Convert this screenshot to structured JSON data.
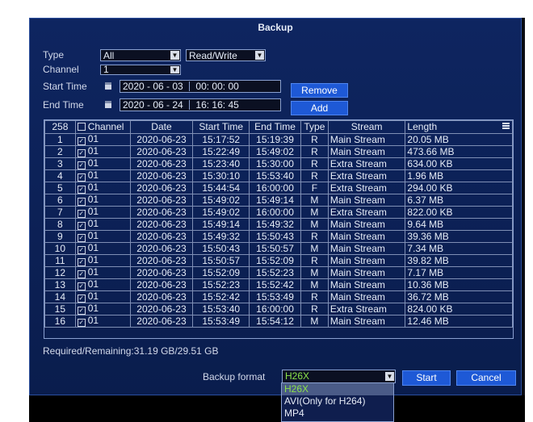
{
  "window": {
    "title": "Backup"
  },
  "filters": {
    "type_label": "Type",
    "type_value": "All",
    "rw_value": "Read/Write",
    "channel_label": "Channel",
    "channel_value": "1",
    "start_label": "Start Time",
    "start_date": "2020 - 06 - 03",
    "start_time": "00: 00: 00",
    "end_label": "End Time",
    "end_date": "2020 - 06 - 24",
    "end_time": "16: 16: 45",
    "remove_label": "Remove",
    "add_label": "Add"
  },
  "table": {
    "count": "258",
    "headers": [
      "Channel",
      "Date",
      "Start Time",
      "End Time",
      "Type",
      "Stream",
      "Length"
    ],
    "rows": [
      {
        "n": "1",
        "ch": "01",
        "date": "2020-06-23",
        "start": "15:17:52",
        "end": "15:19:39",
        "type": "R",
        "stream": "Main Stream",
        "len": "20.05 MB"
      },
      {
        "n": "2",
        "ch": "01",
        "date": "2020-06-23",
        "start": "15:22:49",
        "end": "15:49:02",
        "type": "R",
        "stream": "Main Stream",
        "len": "473.66 MB"
      },
      {
        "n": "3",
        "ch": "01",
        "date": "2020-06-23",
        "start": "15:23:40",
        "end": "15:30:00",
        "type": "R",
        "stream": "Extra Stream",
        "len": "634.00 KB"
      },
      {
        "n": "4",
        "ch": "01",
        "date": "2020-06-23",
        "start": "15:30:10",
        "end": "15:53:40",
        "type": "R",
        "stream": "Extra Stream",
        "len": "1.96 MB"
      },
      {
        "n": "5",
        "ch": "01",
        "date": "2020-06-23",
        "start": "15:44:54",
        "end": "16:00:00",
        "type": "F",
        "stream": "Extra Stream",
        "len": "294.00 KB"
      },
      {
        "n": "6",
        "ch": "01",
        "date": "2020-06-23",
        "start": "15:49:02",
        "end": "15:49:14",
        "type": "M",
        "stream": "Main Stream",
        "len": "6.37 MB"
      },
      {
        "n": "7",
        "ch": "01",
        "date": "2020-06-23",
        "start": "15:49:02",
        "end": "16:00:00",
        "type": "M",
        "stream": "Extra Stream",
        "len": "822.00 KB"
      },
      {
        "n": "8",
        "ch": "01",
        "date": "2020-06-23",
        "start": "15:49:14",
        "end": "15:49:32",
        "type": "M",
        "stream": "Main Stream",
        "len": "9.64 MB"
      },
      {
        "n": "9",
        "ch": "01",
        "date": "2020-06-23",
        "start": "15:49:32",
        "end": "15:50:43",
        "type": "R",
        "stream": "Main Stream",
        "len": "39.36 MB"
      },
      {
        "n": "10",
        "ch": "01",
        "date": "2020-06-23",
        "start": "15:50:43",
        "end": "15:50:57",
        "type": "M",
        "stream": "Main Stream",
        "len": "7.34 MB"
      },
      {
        "n": "11",
        "ch": "01",
        "date": "2020-06-23",
        "start": "15:50:57",
        "end": "15:52:09",
        "type": "R",
        "stream": "Main Stream",
        "len": "39.82 MB"
      },
      {
        "n": "12",
        "ch": "01",
        "date": "2020-06-23",
        "start": "15:52:09",
        "end": "15:52:23",
        "type": "M",
        "stream": "Main Stream",
        "len": "7.17 MB"
      },
      {
        "n": "13",
        "ch": "01",
        "date": "2020-06-23",
        "start": "15:52:23",
        "end": "15:52:42",
        "type": "M",
        "stream": "Main Stream",
        "len": "10.36 MB"
      },
      {
        "n": "14",
        "ch": "01",
        "date": "2020-06-23",
        "start": "15:52:42",
        "end": "15:53:49",
        "type": "R",
        "stream": "Main Stream",
        "len": "36.72 MB"
      },
      {
        "n": "15",
        "ch": "01",
        "date": "2020-06-23",
        "start": "15:53:40",
        "end": "16:00:00",
        "type": "R",
        "stream": "Extra Stream",
        "len": "824.00 KB"
      },
      {
        "n": "16",
        "ch": "01",
        "date": "2020-06-23",
        "start": "15:53:49",
        "end": "15:54:12",
        "type": "M",
        "stream": "Main Stream",
        "len": "12.46 MB"
      }
    ]
  },
  "footer": {
    "storage": "Required/Remaining:31.19 GB/29.51 GB",
    "format_label": "Backup format",
    "format_value": "H26X",
    "start_label": "Start",
    "cancel_label": "Cancel"
  },
  "format_options": [
    "H26X",
    "AVI(Only for H264)",
    "MP4"
  ],
  "colors": {
    "accent": "#1e59d6",
    "background": "#0e2560",
    "selected_text": "#8be24a"
  },
  "icons": [
    "calendar-icon",
    "dropdown-arrow-icon",
    "checkbox-icon",
    "menu-icon"
  ]
}
